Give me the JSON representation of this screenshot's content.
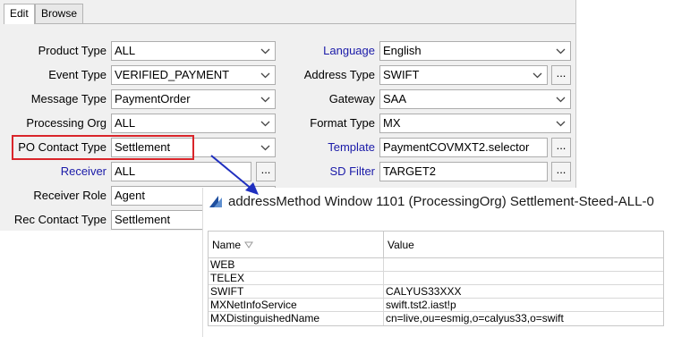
{
  "tabs": [
    {
      "label": "Edit",
      "active": true
    },
    {
      "label": "Browse",
      "active": false
    }
  ],
  "form": {
    "product_type": {
      "label": "Product Type",
      "value": "ALL"
    },
    "event_type": {
      "label": "Event Type",
      "value": "VERIFIED_PAYMENT"
    },
    "message_type": {
      "label": "Message Type",
      "value": "PaymentOrder"
    },
    "processing_org": {
      "label": "Processing Org",
      "value": "ALL"
    },
    "po_contact_type": {
      "label": "PO Contact Type",
      "value": "Settlement"
    },
    "receiver": {
      "label": "Receiver",
      "value": "ALL",
      "button": "..."
    },
    "receiver_role": {
      "label": "Receiver Role",
      "value": "Agent"
    },
    "rec_contact_type": {
      "label": "Rec Contact Type",
      "value": "Settlement"
    },
    "language": {
      "label": "Language",
      "value": "English"
    },
    "address_type": {
      "label": "Address Type",
      "value": "SWIFT",
      "button": "..."
    },
    "gateway": {
      "label": "Gateway",
      "value": "SAA"
    },
    "format_type": {
      "label": "Format Type",
      "value": "MX"
    },
    "template": {
      "label": "Template",
      "value": "PaymentCOVMXT2.selector",
      "button": "..."
    },
    "sd_filter": {
      "label": "SD Filter",
      "value": "TARGET2",
      "button": "..."
    }
  },
  "popup": {
    "title": "addressMethod Window 1101 (ProcessingOrg) Settlement-Steed-ALL-0",
    "columns": [
      "Name",
      "Value"
    ],
    "rows": [
      {
        "name": "WEB",
        "value": ""
      },
      {
        "name": "TELEX",
        "value": ""
      },
      {
        "name": "SWIFT",
        "value": "CALYUS33XXX"
      },
      {
        "name": "MXNetInfoService",
        "value": "swift.tst2.iast!p"
      },
      {
        "name": "MXDistinguishedName",
        "value": "cn=live,ou=esmig,o=calyus33,o=swift"
      }
    ]
  },
  "colors": {
    "highlight": "#d9252a",
    "arrow": "#1f2fbf",
    "link_label": "#1a1aa8"
  }
}
